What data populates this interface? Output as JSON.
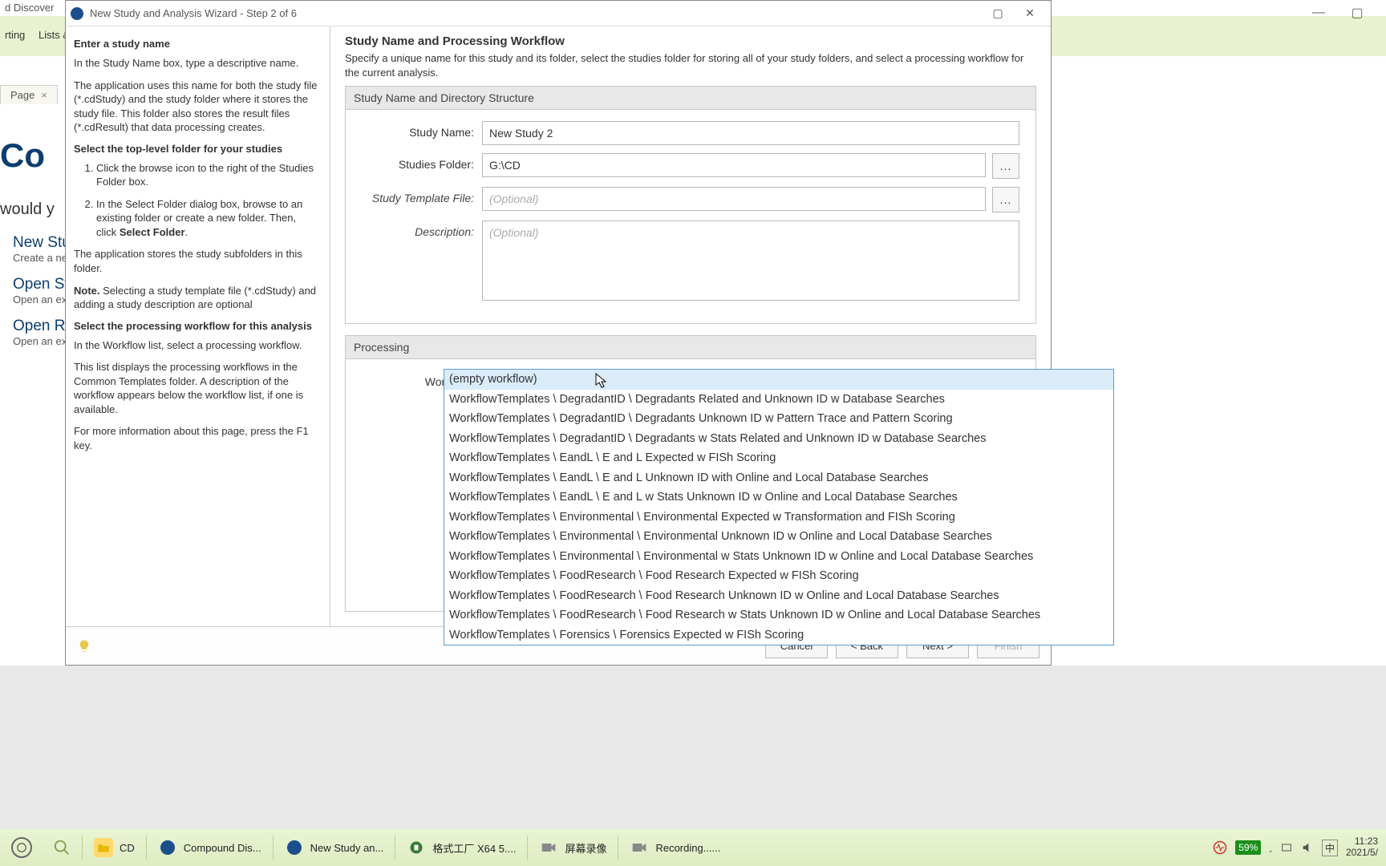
{
  "bgTab": {
    "label": "Page",
    "close": "×"
  },
  "bgLinks": {
    "co": "Co",
    "would": "would y",
    "newStudy": "New Stu",
    "newStudySub": "Create a new",
    "openSt": "Open St",
    "openStSub": "Open an exi",
    "openR": "Open R",
    "openRSub": "Open an exi"
  },
  "bgTop": {
    "discover": "d Discover",
    "rting": "rting",
    "lists": "Lists &"
  },
  "window": {
    "title": "New Study and Analysis Wizard - Step 2 of 6",
    "maximize": "▢",
    "close": "✕",
    "bgMinimize": "—",
    "bgMax": "▢"
  },
  "help": {
    "h1": "Enter a study name",
    "p1": "In the Study Name box, type a descriptive name.",
    "p2": "The application uses this name for both the study file (*.cdStudy) and the study folder where it stores the study file. This folder also stores the result files (*.cdResult) that data processing creates.",
    "h2": "Select the top-level folder for your studies",
    "ol1": "Click the browse icon to the right of the Studies Folder box.",
    "ol2a": "In the Select Folder dialog box, browse to an existing folder or create a new folder. Then, click ",
    "ol2b": "Select Folder",
    "ol2c": ".",
    "p3": "The application stores the study subfolders in this folder.",
    "note": "Note.",
    "noteText": " Selecting a study template file (*.cdStudy) and adding a study description are optional",
    "h3": "Select the processing workflow for this analysis",
    "p4": "In the Workflow list, select a processing workflow.",
    "p5": "This list displays the processing workflows in the Common Templates folder. A description of the workflow appears below the workflow list, if one is available.",
    "p6": "For more information about this page, press the F1 key."
  },
  "content": {
    "heading": "Study Name and Processing Workflow",
    "sub": "Specify a unique name for this study and its folder, select the studies folder for storing all of your study folders, and select a processing workflow for the current analysis.",
    "group1": "Study Name and Directory Structure",
    "studyNameLabel": "Study Name:",
    "studyNameValue": "New Study 2",
    "studiesFolderLabel": "Studies Folder:",
    "studiesFolderValue": "G:\\CD",
    "templateLabel": "Study Template File:",
    "templatePlaceholder": "(Optional)",
    "descLabel": "Description:",
    "descPlaceholder": "(Optional)",
    "group2": "Processing",
    "workflowLabel": "Workflow:",
    "workflowValue": "(empty workflow)",
    "browse": "..."
  },
  "dropdown": [
    "(empty workflow)",
    "WorkflowTemplates \\ DegradantID \\ Degradants Related and Unknown ID w Database Searches",
    "WorkflowTemplates \\ DegradantID \\ Degradants Unknown ID w Pattern Trace and Pattern Scoring",
    "WorkflowTemplates \\ DegradantID \\ Degradants w Stats Related and Unknown ID w Database Searches",
    "WorkflowTemplates \\ EandL \\ E and L Expected w FISh Scoring",
    "WorkflowTemplates \\ EandL \\ E and L Unknown ID with Online and Local Database Searches",
    "WorkflowTemplates \\ EandL \\ E and L w Stats Unknown ID w Online and Local Database Searches",
    "WorkflowTemplates \\ Environmental \\ Environmental Expected w Transformation and FISh Scoring",
    "WorkflowTemplates \\ Environmental \\ Environmental Unknown ID w Online and Local Database Searches",
    "WorkflowTemplates \\ Environmental \\ Environmental w Stats Unknown ID w Online and Local Database Searches",
    "WorkflowTemplates \\ FoodResearch \\ Food Research Expected w FISh Scoring",
    "WorkflowTemplates \\ FoodResearch \\ Food Research Unknown ID w Online and Local Database Searches",
    "WorkflowTemplates \\ FoodResearch \\ Food Research w Stats Unknown ID w Online and Local Database Searches",
    "WorkflowTemplates \\ Forensics \\ Forensics Expected w FISh Scoring"
  ],
  "footer": {
    "cancel": "Cancel",
    "back": "<  Back",
    "next": "Next  >",
    "finish": "Finish"
  },
  "taskbar": {
    "items": [
      {
        "label": "CD"
      },
      {
        "label": "Compound Dis..."
      },
      {
        "label": "New Study an..."
      },
      {
        "label": "格式工厂 X64 5...."
      },
      {
        "label": "屏幕录像"
      },
      {
        "label": "Recording......"
      }
    ],
    "battery": "59%",
    "time": "11:23",
    "date": "2021/5/",
    "ime": "中"
  }
}
